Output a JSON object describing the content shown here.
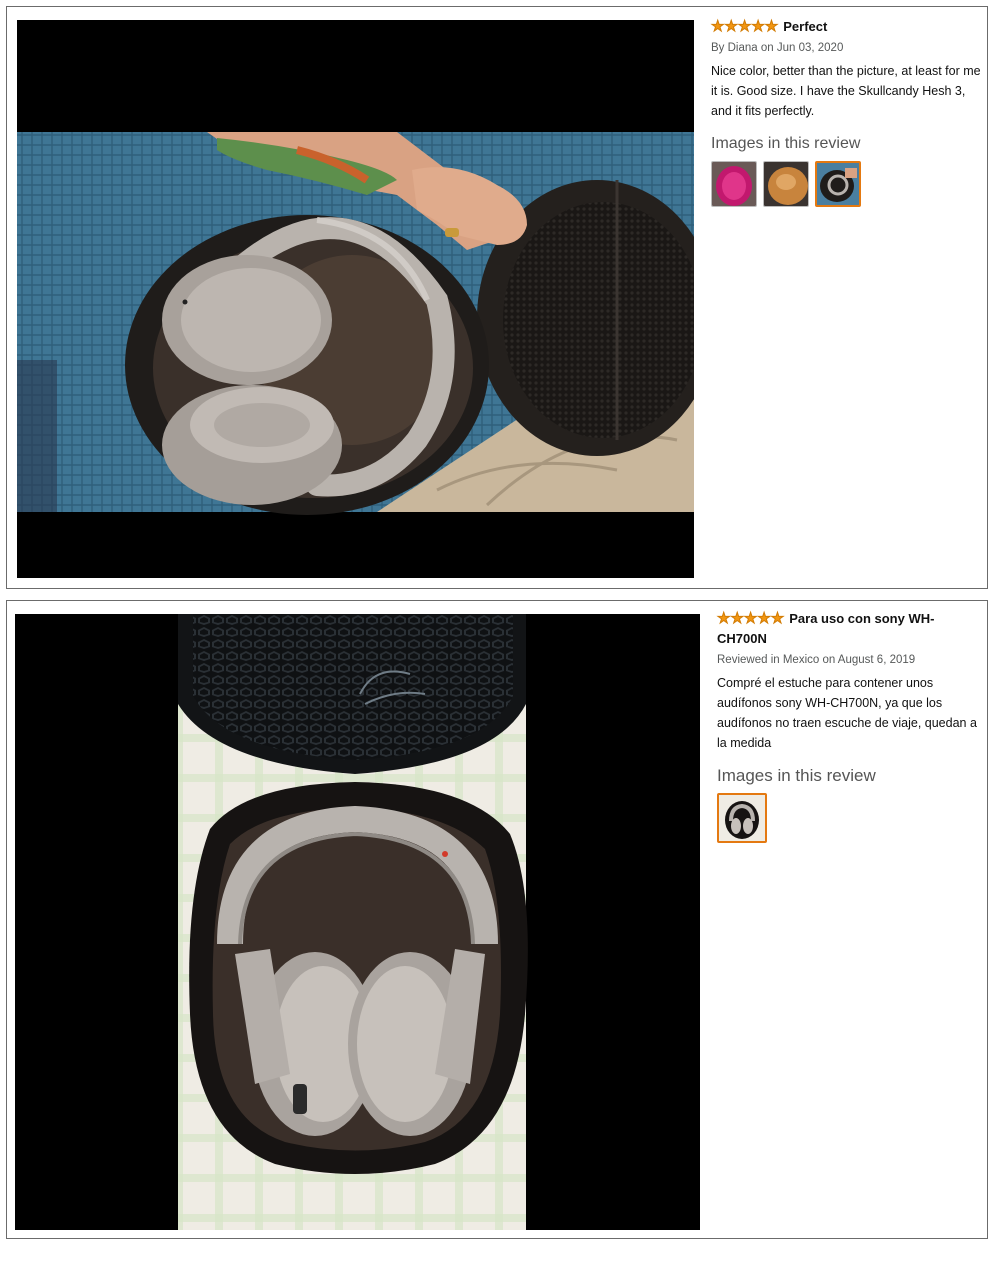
{
  "reviews": [
    {
      "stars": "★★★★★",
      "title": "Perfect",
      "byline": "By Diana on Jun 03, 2020",
      "body": "Nice color, better than the picture, at least for me it is. Good size. I have the Skullcandy Hesh 3, and it fits perfectly.",
      "images_heading": "Images in this review",
      "thumbnails": [
        "pink-case-thumbnail",
        "tan-case-thumbnail",
        "headphones-in-case-thumbnail"
      ],
      "selected_thumbnail": 3
    },
    {
      "stars": "★★★★★",
      "title": "Para uso con sony WH-CH700N",
      "byline": "Reviewed in Mexico on August 6, 2019",
      "body": "Compré el estuche para contener unos audífonos sony WH-CH700N, ya que los audífonos no traen escuche de viaje, quedan a la medida",
      "images_heading": "Images in this review",
      "thumbnails": [
        "headphones-in-case-thumbnail"
      ],
      "selected_thumbnail": 1
    }
  ],
  "colors": {
    "star": "#f29611",
    "selected_border": "#e47911",
    "case_black": "#1e1b19",
    "headphone_grey": "#b8b3ae",
    "blanket_blue": "#4a7fa0"
  }
}
